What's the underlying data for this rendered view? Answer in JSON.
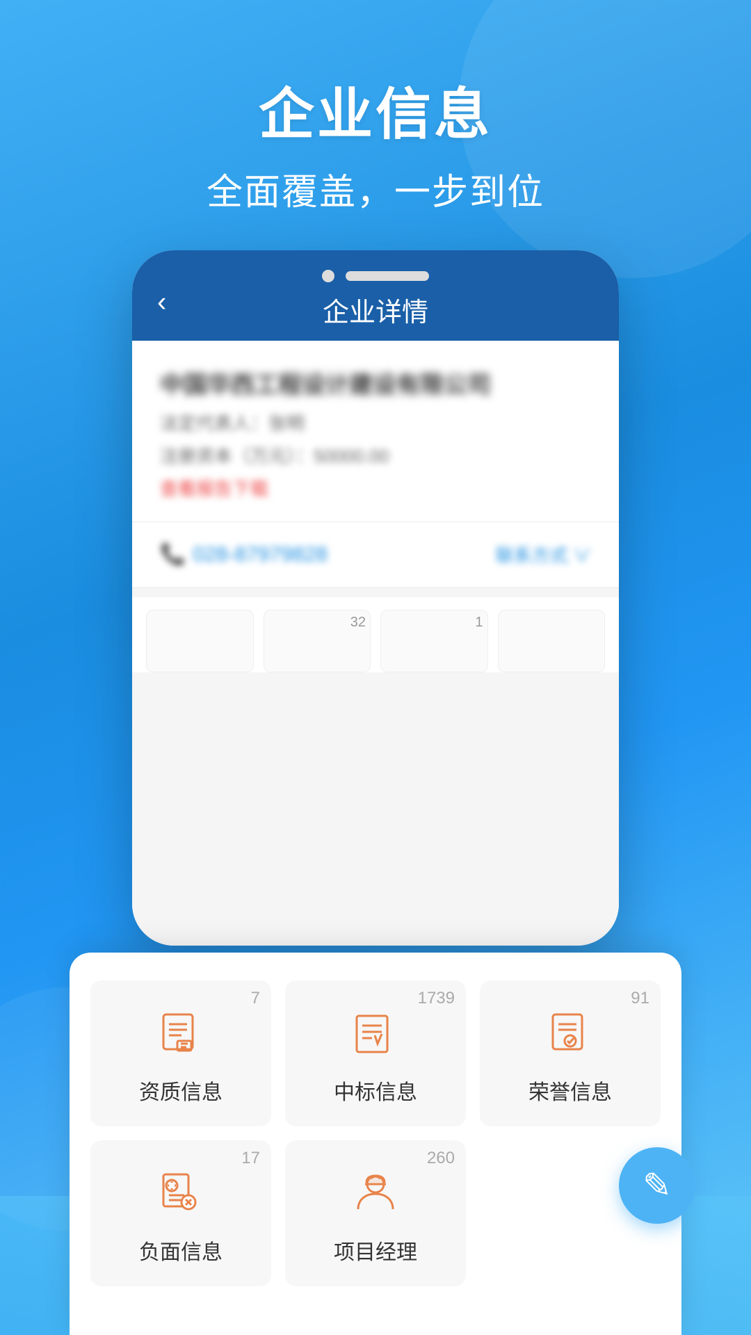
{
  "header": {
    "title": "企业信息",
    "subtitle": "全面覆盖，一步到位"
  },
  "phone": {
    "navbar": {
      "back_label": "‹",
      "title": "企业详情"
    },
    "company": {
      "name": "中国华西工程设计建设有限公司",
      "legal_person_label": "法定代表人：",
      "legal_person": "张明",
      "reg_capital_label": "注册资本（万元）：",
      "reg_capital": "50000.00",
      "link_text": "查看报告下载"
    },
    "contact": {
      "phone": "028-87979828",
      "contact_link": "联系方式 ∨"
    },
    "stats": [
      {
        "badge": "",
        "icon": "building"
      },
      {
        "badge": "32",
        "icon": "doc-search"
      },
      {
        "badge": "1",
        "icon": "bank"
      },
      {
        "badge": "",
        "icon": "book"
      }
    ]
  },
  "grid": {
    "rows": [
      [
        {
          "id": "qualification",
          "label": "资质信息",
          "badge": "7",
          "icon": "qualification"
        },
        {
          "id": "bid",
          "label": "中标信息",
          "badge": "1739",
          "icon": "bid"
        },
        {
          "id": "honor",
          "label": "荣誉信息",
          "badge": "91",
          "icon": "honor"
        }
      ],
      [
        {
          "id": "negative",
          "label": "负面信息",
          "badge": "17",
          "icon": "negative"
        },
        {
          "id": "manager",
          "label": "项目经理",
          "badge": "260",
          "icon": "manager"
        },
        {
          "id": "empty",
          "label": "",
          "badge": "",
          "icon": "none"
        }
      ]
    ]
  },
  "fab": {
    "icon": "✎"
  }
}
